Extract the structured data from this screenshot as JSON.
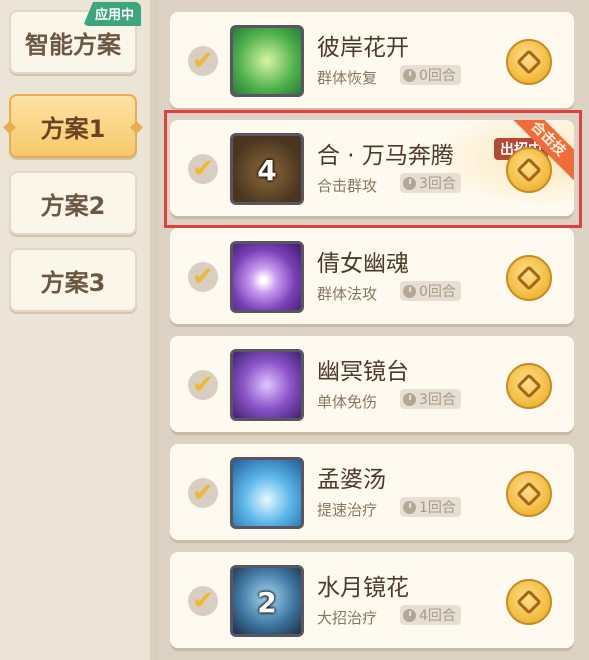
{
  "sidebar": {
    "tabs": [
      {
        "label": "智能方案",
        "badge": "应用中"
      },
      {
        "label": "方案1"
      },
      {
        "label": "方案2"
      },
      {
        "label": "方案3"
      }
    ]
  },
  "skills": [
    {
      "name": "彼岸花开",
      "type": "群体恢复",
      "turns": "0回合",
      "icon": "green-bloom-icon"
    },
    {
      "name": "合 · 万马奔腾",
      "type": "合击群攻",
      "turns": "3回合",
      "icon": "horse-herd-icon",
      "number": "4",
      "tag": "出招中",
      "ribbon": "合击技"
    },
    {
      "name": "倩女幽魂",
      "type": "群体法攻",
      "turns": "0回合",
      "icon": "purple-spirit-icon"
    },
    {
      "name": "幽冥镜台",
      "type": "单体免伤",
      "turns": "3回合",
      "icon": "purple-mirror-icon"
    },
    {
      "name": "孟婆汤",
      "type": "提速治疗",
      "turns": "1回合",
      "icon": "blue-soup-icon"
    },
    {
      "name": "水月镜花",
      "type": "大招治疗",
      "turns": "4回合",
      "icon": "water-moon-icon",
      "number": "2"
    }
  ],
  "colors": {
    "accent": "#f7c86a",
    "check": "#f0b933",
    "badge": "#3fa57f",
    "highlight": "#e23f3f"
  }
}
